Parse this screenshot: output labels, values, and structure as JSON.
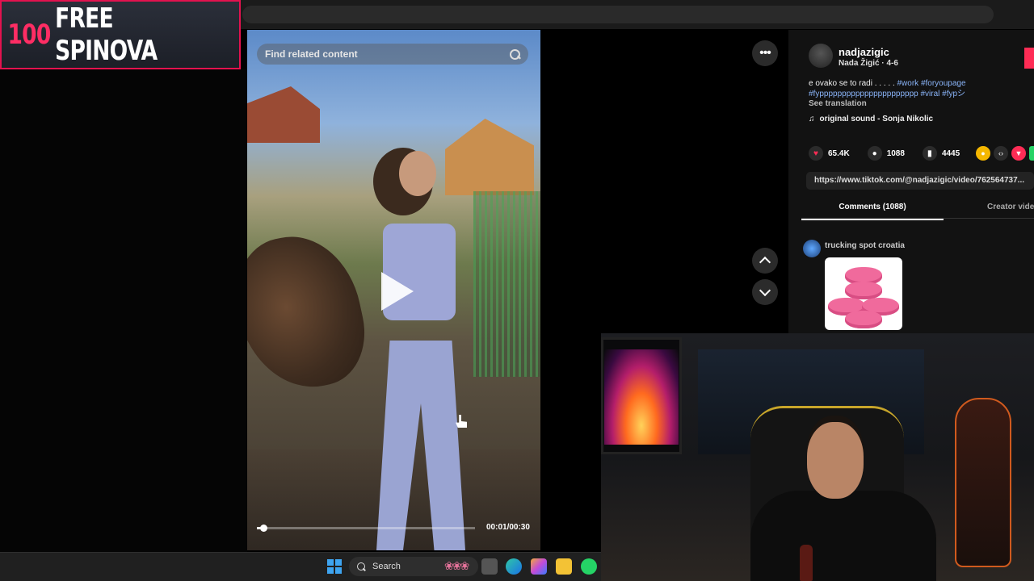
{
  "banner": {
    "number": "100",
    "text": "FREE SPINOVA"
  },
  "video": {
    "search_placeholder": "Find related content",
    "time": "00:01/00:30",
    "progress": 0.033
  },
  "post": {
    "username": "nadjazigic",
    "nickname": "Nada Žigić · 4-6",
    "description": "e ovako se to radi . . . . .",
    "hashtags": "#work #foryoupage #fypppppppppppppppppppppp #viral #fypシ",
    "see_translation": "See translation",
    "sound": "original sound - Sonja Nikolic",
    "likes": "65.4K",
    "comments": "1088",
    "saves": "4445",
    "link": "https://www.tiktok.com/@nadjazigic/video/762564737..."
  },
  "tabs": {
    "comments": "Comments (1088)",
    "creator": "Creator vide"
  },
  "comment": {
    "user": "trucking spot croatia"
  },
  "taskbar": {
    "search": "Search"
  },
  "colors": {
    "accent": "#fe2c55",
    "banner_border": "#e3124f",
    "hashtag": "#8ab4f8"
  }
}
